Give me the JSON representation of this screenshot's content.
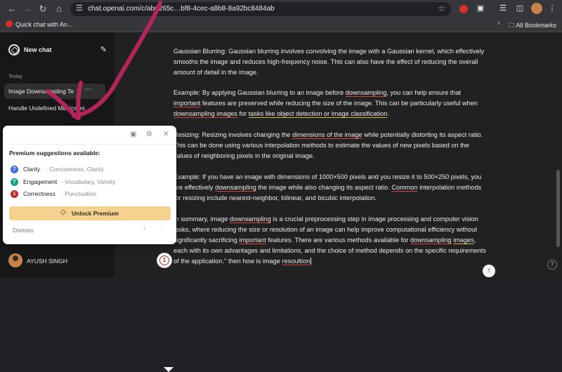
{
  "browser": {
    "url": "chat.openai.com/c/abd265c…bf8-4cec-a8b8-8a92bc8484ab",
    "icons": {
      "back": "back-arrow-icon",
      "forward": "forward-arrow-icon",
      "reload": "reload-icon",
      "home": "home-icon",
      "site_settings": "tune-icon",
      "bookmark": "star-icon"
    }
  },
  "bookmarks": {
    "item": "Quick chat with An...",
    "all_bookmarks": "All Bookmarks"
  },
  "sidebar": {
    "new_chat": "New chat",
    "section_today": "Today",
    "conversations": [
      {
        "label": "Image Downsampling Te"
      },
      {
        "label": "Handle Undefined Metrics ini"
      }
    ],
    "user_name": "AYUSH SINGH"
  },
  "message": {
    "p1": {
      "a": "Gaussian Blurring: Gaussian blurring involves convolving the image with a Gaussian kernel, which effectively smooths the image and reduces high-frequency noise. This can also have the effect of reducing the overall amount of detail in the image."
    },
    "p2": {
      "a": "Example: By applying Gaussian blurring to an image before ",
      "b": "downsampling",
      "c": ", you can help ensure that ",
      "d": "important",
      "e": " features are preserved while reducing the size of the image. This can be particularly useful when ",
      "f": "downsampling images",
      "g": " for ",
      "h": "tasks like object detection or image classification",
      "i": "."
    },
    "p3": {
      "a": "Resizing: Resizing involves changing the ",
      "b": "dimensions of the image",
      "c": " while potentially distorting its aspect ratio. This can be done using various interpolation methods to estimate the values of new pixels based on the values of neighboring pixels in the original image."
    },
    "p4": {
      "a": "Example: If you have an image with dimensions of 1000×500 pixels and you resize it to 500×250 pixels, you are effectively ",
      "b": "downsampling",
      "c": " the image while also changing its aspect ratio. ",
      "d": "Common",
      "e": " interpolation methods for resizing include nearest-neighbor, bilinear, and bicubic interpolation."
    },
    "p5": {
      "a": "In summary, image ",
      "b": "downsampling",
      "c": " is a crucial preprocessing step in image processing and computer vision tasks, where reducing the size or resolution of an image can help improve computational efficiency without significantly sacrificing ",
      "d": "important",
      "e": " features. There are various methods available for ",
      "f": "downsampling",
      "g": " ",
      "h": "images",
      "i": ", each with its own advantages and limitations, and the choice of method depends on the specific requirements of the application.\" then how is image ",
      "j": "resoultion"
    }
  },
  "grammarly": {
    "title": "Premium suggestions available:",
    "suggestions": [
      {
        "count": "7",
        "name": "Clarity",
        "sub": "· Conciseness, Clarity",
        "color": "#4a6ee0"
      },
      {
        "count": "7",
        "name": "Engagement",
        "sub": "· Vocabulary, Variety",
        "color": "#15a38a"
      },
      {
        "count": "1",
        "name": "Correctness",
        "sub": "· Punctuation",
        "color": "#c0262d"
      }
    ],
    "unlock_label": "Unlock Premium",
    "dismiss_label": "Dismiss",
    "badge_count": "1",
    "accent": "#f5d38f"
  },
  "colors": {
    "sidebar_bg": "#171717",
    "main_bg": "#212121",
    "annotation_arrow": "#b3245c"
  }
}
